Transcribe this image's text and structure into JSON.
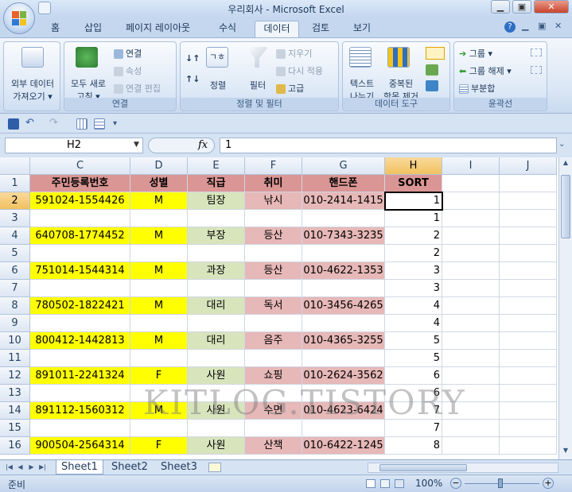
{
  "window": {
    "title": "우리회사 - Microsoft Excel",
    "minimize": "▁",
    "restore": "▣",
    "close": "✕"
  },
  "ribbon_tabs": [
    "홈",
    "삽입",
    "페이지 레이아웃",
    "수식",
    "데이터",
    "검토",
    "보기"
  ],
  "active_tab": "데이터",
  "ribbon": {
    "ext_data": {
      "line1": "외부 데이터",
      "line2": "가져오기 ▾"
    },
    "connections": {
      "refresh_line1": "모두 새로",
      "refresh_line2": "고침 ▾",
      "connect": "연결",
      "properties": "속성",
      "edit_links": "연결 편집",
      "label": "연결"
    },
    "sort_filter": {
      "az_label": "",
      "sort": "정렬",
      "filter": "필터",
      "clear": "지우기",
      "reapply": "다시 적용",
      "advanced": "고급",
      "label": "정렬 및 필터"
    },
    "data_tools": {
      "text_line1": "텍스트",
      "text_line2": "나누기",
      "dup_line1": "중복된",
      "dup_line2": "항목 제거",
      "label": "데이터 도구"
    },
    "outline": {
      "group": "그룹 ▾",
      "ungroup": "그룹 해제 ▾",
      "subtotal": "부분합",
      "label": "윤곽선"
    }
  },
  "formula_bar": {
    "name_box": "H2",
    "fx": "fx",
    "value": "1"
  },
  "columns": [
    "C",
    "D",
    "E",
    "F",
    "G",
    "H",
    "I",
    "J"
  ],
  "header_row": {
    "row": "1",
    "cells": [
      "주민등록번호",
      "성별",
      "직급",
      "취미",
      "핸드폰",
      "SORT",
      "",
      ""
    ]
  },
  "rows": [
    {
      "row": "2",
      "cells": [
        "591024-1554426",
        "M",
        "팀장",
        "낚시",
        "010-2414-1415",
        "1",
        "",
        ""
      ]
    },
    {
      "row": "3",
      "cells": [
        "",
        "",
        "",
        "",
        "",
        "1",
        "",
        ""
      ]
    },
    {
      "row": "4",
      "cells": [
        "640708-1774452",
        "M",
        "부장",
        "등산",
        "010-7343-3235",
        "2",
        "",
        ""
      ]
    },
    {
      "row": "5",
      "cells": [
        "",
        "",
        "",
        "",
        "",
        "2",
        "",
        ""
      ]
    },
    {
      "row": "6",
      "cells": [
        "751014-1544314",
        "M",
        "과장",
        "등산",
        "010-4622-1353",
        "3",
        "",
        ""
      ]
    },
    {
      "row": "7",
      "cells": [
        "",
        "",
        "",
        "",
        "",
        "3",
        "",
        ""
      ]
    },
    {
      "row": "8",
      "cells": [
        "780502-1822421",
        "M",
        "대리",
        "독서",
        "010-3456-4265",
        "4",
        "",
        ""
      ]
    },
    {
      "row": "9",
      "cells": [
        "",
        "",
        "",
        "",
        "",
        "4",
        "",
        ""
      ]
    },
    {
      "row": "10",
      "cells": [
        "800412-1442813",
        "M",
        "대리",
        "음주",
        "010-4365-3255",
        "5",
        "",
        ""
      ]
    },
    {
      "row": "11",
      "cells": [
        "",
        "",
        "",
        "",
        "",
        "5",
        "",
        ""
      ]
    },
    {
      "row": "12",
      "cells": [
        "891011-2241324",
        "F",
        "사원",
        "쇼핑",
        "010-2624-3562",
        "6",
        "",
        ""
      ]
    },
    {
      "row": "13",
      "cells": [
        "",
        "",
        "",
        "",
        "",
        "6",
        "",
        ""
      ]
    },
    {
      "row": "14",
      "cells": [
        "891112-1560312",
        "M",
        "사원",
        "수면",
        "010-4623-6424",
        "7",
        "",
        ""
      ]
    },
    {
      "row": "15",
      "cells": [
        "",
        "",
        "",
        "",
        "",
        "7",
        "",
        ""
      ]
    },
    {
      "row": "16",
      "cells": [
        "900504-2564314",
        "F",
        "사원",
        "산책",
        "010-6422-1245",
        "8",
        "",
        ""
      ]
    }
  ],
  "watermark": "KITLOG.TISTORY",
  "sheets": [
    "Sheet1",
    "Sheet2",
    "Sheet3"
  ],
  "active_sheet": "Sheet1",
  "status": {
    "ready": "준비",
    "zoom": "100%"
  },
  "colors": {
    "yellow": "#ffff00",
    "green": "#d8e4bc",
    "pink": "#e6b8b7",
    "header": "#da9694"
  }
}
